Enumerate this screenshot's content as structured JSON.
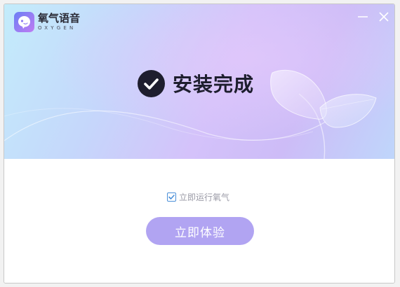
{
  "app": {
    "name": "氧气语音",
    "subtitle": "OXYGEN",
    "logo_icon": "oxygen-bubble-logo"
  },
  "window_controls": {
    "minimize_icon": "minimize-icon",
    "close_icon": "close-icon"
  },
  "banner": {
    "status_icon": "check-circle-icon",
    "title": "安装完成"
  },
  "options": {
    "launch_now": {
      "label": "立即运行氧气",
      "checked": true
    }
  },
  "actions": {
    "primary_label": "立即体验"
  },
  "colors": {
    "primary_button": "#b1a4f2",
    "checkbox_accent": "#4a8fd8",
    "title_text": "#1e1e2e",
    "logo_gradient_start": "#6b7ff5",
    "logo_gradient_end": "#c07cf2"
  }
}
